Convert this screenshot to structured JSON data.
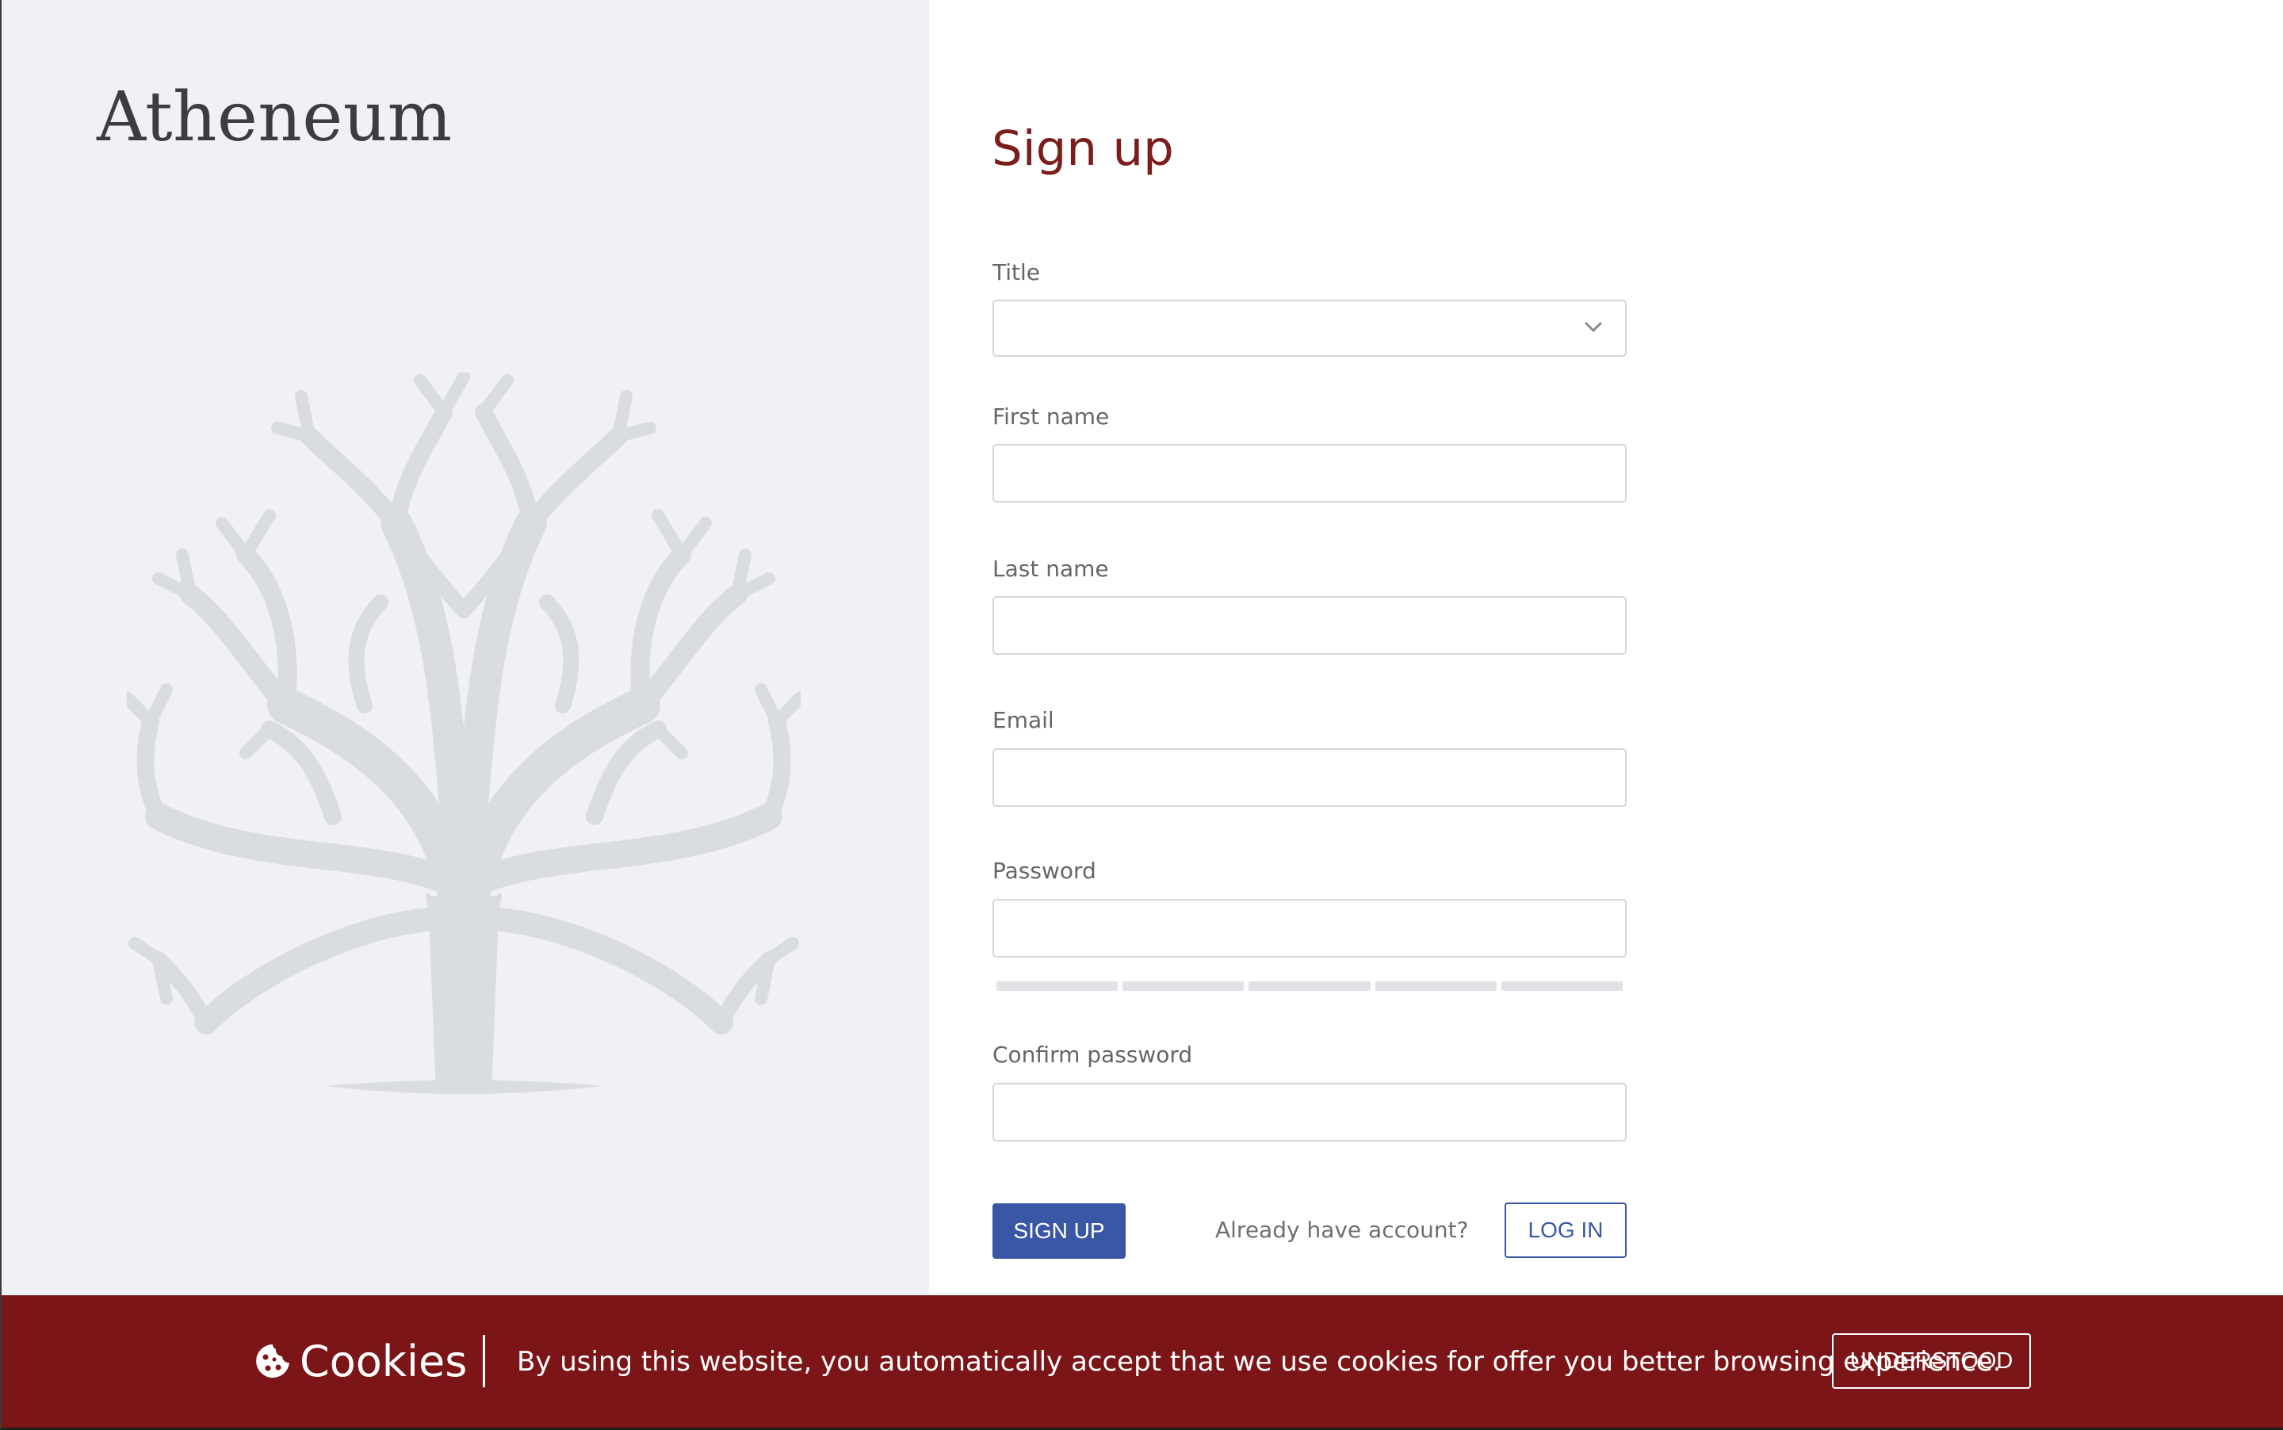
{
  "brand": {
    "name": "Atheneum"
  },
  "form": {
    "heading": "Sign up",
    "fields": {
      "title": {
        "label": "Title",
        "value": ""
      },
      "first_name": {
        "label": "First name",
        "value": "",
        "placeholder": ""
      },
      "last_name": {
        "label": "Last name",
        "value": "",
        "placeholder": ""
      },
      "email": {
        "label": "Email",
        "value": "",
        "placeholder": ""
      },
      "password": {
        "label": "Password",
        "value": "",
        "placeholder": ""
      },
      "confirm_password": {
        "label": "Confirm password",
        "value": "",
        "placeholder": ""
      }
    },
    "password_strength_segments": 5,
    "password_strength_filled": 0,
    "signup_label": "SIGN UP",
    "already_text": "Already have account?",
    "login_label": "LOG IN"
  },
  "cookie_banner": {
    "title": "Cookies",
    "message": "By using this website, you automatically accept that we use cookies for offer you better browsing experience.",
    "button_label": "UNDERSTOOD"
  },
  "colors": {
    "accent_red": "#7b1d1a",
    "banner_red": "#7b1517",
    "primary_blue": "#3a57a6",
    "left_panel_bg": "#f1f1f5",
    "tree_gray": "#d9dce1"
  },
  "icons": [
    "tree-logo-icon",
    "chevron-down-icon",
    "cookie-icon"
  ]
}
